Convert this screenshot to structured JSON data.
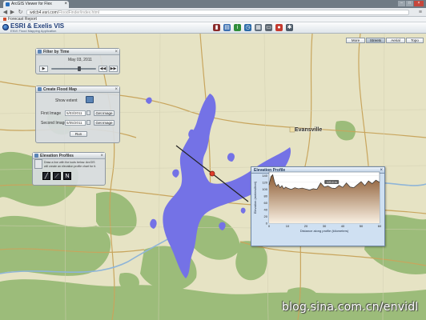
{
  "browser": {
    "tab_title": "ArcGIS Viewer for Flex",
    "tab_close": "×",
    "window_buttons": [
      "–",
      "□",
      "×"
    ],
    "back": "◀",
    "forward": "▶",
    "reload": "↻",
    "url_host": "wdcb4.esri.com",
    "url_path": "/FloodFinder/index.html",
    "wrench": "≡",
    "bookmark": "Forecast Report"
  },
  "app": {
    "title": "ESRI & Exelis VIS",
    "subtitle": "ENVI Flood Mapping Application",
    "logo": "globe-icon",
    "toolbar": [
      {
        "name": "book-icon",
        "glyph": "▮",
        "color": "#8a2b2b"
      },
      {
        "name": "layers-icon",
        "glyph": "▤",
        "color": "#3b6fb0"
      },
      {
        "name": "info-icon",
        "glyph": "i",
        "color": "#2f8d3a"
      },
      {
        "name": "clock-icon",
        "glyph": "◷",
        "color": "#2b6aa8"
      },
      {
        "name": "chart-icon",
        "glyph": "▦",
        "color": "#5f6e7d"
      },
      {
        "name": "print-icon",
        "glyph": "▭",
        "color": "#5c6670"
      },
      {
        "name": "record-icon",
        "glyph": "●",
        "color": "#c43a2f"
      },
      {
        "name": "gear-icon",
        "glyph": "✱",
        "color": "#4c5a68"
      }
    ]
  },
  "basemaps": [
    {
      "label": "More",
      "active": false
    },
    {
      "label": "Streets",
      "active": true
    },
    {
      "label": "Aerial",
      "active": false
    },
    {
      "label": "Topo",
      "active": false
    }
  ],
  "map": {
    "city": "Evansville",
    "tree_color": "#9cbc7a",
    "flood_color": "#7472e6",
    "road_color": "#c8a55d"
  },
  "filter_by_time": {
    "title": "Filter by Time",
    "date": "May 03, 2011",
    "controls": {
      "play": "▶",
      "prev": "◀◀",
      "next": "▶▶"
    },
    "slider_fraction": 0.62
  },
  "flood_map": {
    "title": "Create Flood Map",
    "show_extent": "Show extent",
    "first_label": "First Image",
    "first_value": "5/03/2011",
    "second_label": "Second Image",
    "second_value": "5/05/2011",
    "get_image": "Get Image",
    "run": "Run"
  },
  "elevation": {
    "title": "Elevation Profiles",
    "note_line1": "Draw a line with the tools below. ArcGIS",
    "note_line2": "will create an elevation profile chart for it."
  },
  "chart_data": {
    "type": "area",
    "title": "Elevation Profile",
    "xlabel": "Distance along profile (kilometers)",
    "ylabel": "Elevation (meters/feet)",
    "xlim": [
      0,
      60
    ],
    "ylim": [
      0,
      150
    ],
    "xticks": [
      0,
      10,
      20,
      30,
      40,
      50,
      60
    ],
    "yticks": [
      0,
      20,
      40,
      60,
      80,
      100,
      120,
      140
    ],
    "x": [
      0,
      1,
      2,
      3,
      4,
      5,
      6,
      7,
      8,
      9,
      10,
      12,
      14,
      16,
      18,
      20,
      22,
      24,
      26,
      28,
      30,
      32,
      34,
      36,
      38,
      40,
      42,
      44,
      46,
      48,
      50,
      52,
      54,
      56,
      58,
      60
    ],
    "y": [
      112,
      136,
      142,
      120,
      108,
      114,
      104,
      110,
      101,
      106,
      103,
      99,
      104,
      101,
      103,
      100,
      97,
      101,
      99,
      118,
      106,
      109,
      103,
      102,
      111,
      105,
      118,
      106,
      104,
      113,
      122,
      110,
      124,
      116,
      126,
      120
    ],
    "highlight_label": "120.4 m",
    "fill_top": "#8c5b33",
    "fill_bottom": "#f8efe1",
    "line_color": "#333333"
  },
  "watermark": "blog.sina.com.cn/envidl"
}
